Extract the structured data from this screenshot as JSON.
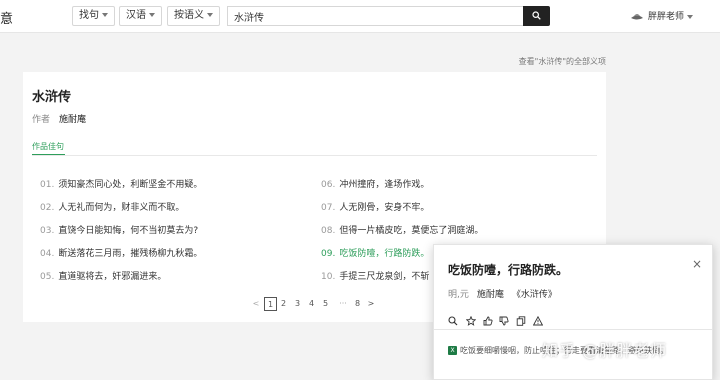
{
  "header": {
    "logo_text": "意",
    "select_mode": "找句",
    "select_language": "汉语",
    "select_search_type": "按语义",
    "search_value": "水浒传",
    "user_name": "胖胖老师"
  },
  "view_all_text": "查看\"水浒传\"的全部义项",
  "book": {
    "title": "水浒传",
    "author_label": "作者",
    "author_name": "施耐庵",
    "tab_label": "作品佳句"
  },
  "sentences": [
    {
      "num": "01.",
      "text": "须知豪杰同心处，利断坚金不用疑。"
    },
    {
      "num": "02.",
      "text": "人无礼而何为，财非义而不取。"
    },
    {
      "num": "03.",
      "text": "直饶今日能知悔，何不当初莫去为?"
    },
    {
      "num": "04.",
      "text": "断送落花三月雨，摧残杨柳九秋霜。"
    },
    {
      "num": "05.",
      "text": "直道驱将去，奸邪漏进来。"
    },
    {
      "num": "06.",
      "text": "冲州撞府，逢场作戏。"
    },
    {
      "num": "07.",
      "text": "人无刚骨，安身不牢。"
    },
    {
      "num": "08.",
      "text": "但得一片橘皮吃，莫便忘了洞庭湖。"
    },
    {
      "num": "09.",
      "text": "吃饭防噎，行路防跌。"
    },
    {
      "num": "10.",
      "text": "手提三尺龙泉剑，不斩"
    }
  ],
  "pagination": {
    "prev": "<",
    "pages": [
      "1",
      "2",
      "3",
      "4",
      "5"
    ],
    "ellipsis": "···",
    "last": "8",
    "next": ">",
    "current": "1"
  },
  "popup": {
    "sentence": "吃饭防噎，行路防跌。",
    "dynasty": "明,元",
    "author": "施耐庵",
    "book": "《水浒传》",
    "close": "×",
    "excel_badge": "X",
    "link_text": "吃饭要细嚼慢咽，防止噎住；行走要看清楚路，避免跌倒。"
  },
  "watermark": "知乎 @胖胖老师",
  "colors": {
    "accent_green": "#2e9e5b",
    "search_button": "#222222"
  }
}
